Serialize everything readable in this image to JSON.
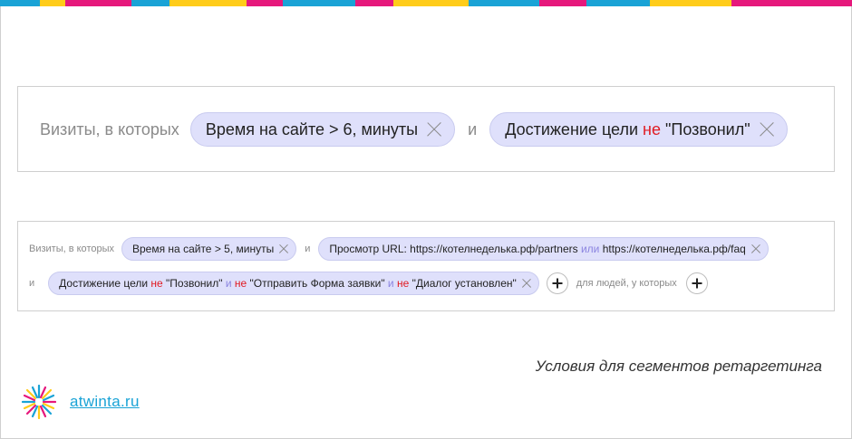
{
  "stripe_colors": [
    "#1aa3d6",
    "#ffcc1a",
    "#e6187c",
    "#1aa3d6",
    "#ffcc1a",
    "#e6187c",
    "#1aa3d6",
    "#e6187c",
    "#ffcc1a",
    "#1aa3d6",
    "#e6187c",
    "#1aa3d6",
    "#ffcc1a",
    "#e6187c"
  ],
  "big": {
    "label": "Визиты, в которых",
    "chip1": "Время на сайте > 6, минуты",
    "and": "и",
    "chip2_a": "Достижение цели ",
    "chip2_neg": "не",
    "chip2_b": " \"Позвонил\""
  },
  "small": {
    "label": "Визиты, в которых",
    "chip1": "Время на сайте > 5, минуты",
    "and1": "и",
    "chip2_a": "Просмотр URL: https://котелнеделька.рф/partners ",
    "chip2_or": "или",
    "chip2_b": " https://котелнеделька.рф/faq",
    "and2": "и",
    "chip3_a": "Достижение цели ",
    "chip3_neg1": "не",
    "chip3_b": " \"Позвонил\" ",
    "chip3_and1": "и",
    "chip3_neg2": " не",
    "chip3_c": " \"Отправить Форма заявки\" ",
    "chip3_and2": "и",
    "chip3_neg3": " не",
    "chip3_d": " \"Диалог установлен\"",
    "people_label": "для людей, у которых"
  },
  "caption": "Условия для сегментов ретаргетинга",
  "logo_text": "atwinta.ru",
  "colors": {
    "chip_bg": "#dfe0fb",
    "negation": "#e01a22",
    "operator": "#8b84e0",
    "link": "#1aa3d6"
  }
}
